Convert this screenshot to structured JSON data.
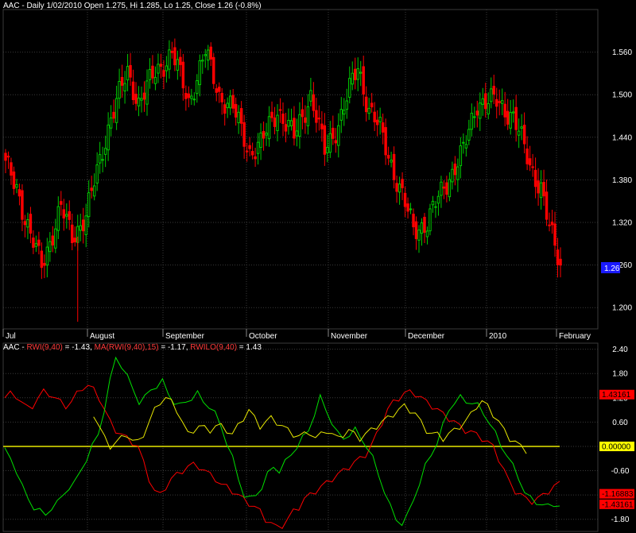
{
  "chart_data": [
    {
      "type": "candlestick",
      "title": "AAC - Daily 1/02/2010 Open 1.275, Hi 1.285, Lo 1.25, Close 1.26 (-0.8%)",
      "ylim": [
        1.17,
        1.62
      ],
      "yticks": [
        "1.560",
        "1.500",
        "1.440",
        "1.380",
        "1.320",
        "1.260",
        "1.200"
      ],
      "last_price_label": "1.26",
      "x_labels": [
        "Jul",
        "August",
        "September",
        "October",
        "November",
        "December",
        "2010",
        "February"
      ],
      "grid": true,
      "colors": {
        "up": "#00c800",
        "down": "#ff0000",
        "grid": "#3a3a3a"
      },
      "waypoints": [
        {
          "bar": 0,
          "close": 1.4
        },
        {
          "bar": 4,
          "close": 1.37
        },
        {
          "bar": 9,
          "close": 1.3
        },
        {
          "bar": 13,
          "close": 1.26
        },
        {
          "bar": 20,
          "close": 1.34
        },
        {
          "bar": 24,
          "close": 1.3
        },
        {
          "bar": 29,
          "close": 1.33
        },
        {
          "bar": 33,
          "close": 1.39
        },
        {
          "bar": 38,
          "close": 1.47
        },
        {
          "bar": 44,
          "close": 1.53
        },
        {
          "bar": 48,
          "close": 1.49
        },
        {
          "bar": 54,
          "close": 1.53
        },
        {
          "bar": 60,
          "close": 1.56
        },
        {
          "bar": 66,
          "close": 1.49
        },
        {
          "bar": 72,
          "close": 1.56
        },
        {
          "bar": 77,
          "close": 1.5
        },
        {
          "bar": 82,
          "close": 1.48
        },
        {
          "bar": 88,
          "close": 1.42
        },
        {
          "bar": 92,
          "close": 1.43
        },
        {
          "bar": 98,
          "close": 1.48
        },
        {
          "bar": 104,
          "close": 1.44
        },
        {
          "bar": 110,
          "close": 1.5
        },
        {
          "bar": 115,
          "close": 1.42
        },
        {
          "bar": 120,
          "close": 1.46
        },
        {
          "bar": 127,
          "close": 1.54
        },
        {
          "bar": 131,
          "close": 1.48
        },
        {
          "bar": 135,
          "close": 1.45
        },
        {
          "bar": 141,
          "close": 1.38
        },
        {
          "bar": 147,
          "close": 1.31
        },
        {
          "bar": 152,
          "close": 1.32
        },
        {
          "bar": 158,
          "close": 1.37
        },
        {
          "bar": 165,
          "close": 1.42
        },
        {
          "bar": 170,
          "close": 1.49
        },
        {
          "bar": 177,
          "close": 1.49
        },
        {
          "bar": 183,
          "close": 1.47
        },
        {
          "bar": 189,
          "close": 1.4
        },
        {
          "bar": 193,
          "close": 1.37
        },
        {
          "bar": 196,
          "close": 1.31
        },
        {
          "bar": 200,
          "close": 1.26
        }
      ],
      "bar_count": 201
    },
    {
      "type": "line",
      "title": "RWI indicator",
      "header": [
        {
          "text": "AAC - ",
          "color": "#ffffff"
        },
        {
          "text": "RWI(9,40)",
          "color": "#ff3b3b"
        },
        {
          "text": " = -1.43, ",
          "color": "#ffffff"
        },
        {
          "text": "MA(RWI(9,40),15)",
          "color": "#ff3b3b"
        },
        {
          "text": " = -1.17, ",
          "color": "#ffffff"
        },
        {
          "text": "RWILO(9,40)",
          "color": "#ff3b3b"
        },
        {
          "text": " = 1.43",
          "color": "#ffffff"
        }
      ],
      "ylim": [
        -2.1,
        2.55
      ],
      "yticks": [
        "2.40",
        "1.80",
        "1.20",
        "0.60",
        "0",
        "-0.60",
        "-1.20",
        "-1.80"
      ],
      "zero_line": 0,
      "value_labels": [
        {
          "text": "1.43161",
          "value": 1.28,
          "bg": "#ff0000",
          "fg": "#000000"
        },
        {
          "text": "0.00000",
          "value": 0,
          "bg": "#ffff00",
          "fg": "#000000"
        },
        {
          "text": "-1.16883",
          "value": -1.17,
          "bg": "#ff0000",
          "fg": "#000000"
        },
        {
          "text": "-1.43161",
          "value": -1.43,
          "bg": "#ff0000",
          "fg": "#000000"
        }
      ],
      "series": [
        {
          "color": "#ff0000",
          "values": [
            1.2,
            1.3,
            1.25,
            1.1,
            0.95,
            1.0,
            1.2,
            1.35,
            1.3,
            1.2,
            1.1,
            1.0,
            1.1,
            1.3,
            1.45,
            1.5,
            1.4,
            1.2,
            0.9,
            0.6,
            0.4,
            0.3,
            0.2,
            0.1,
            0.0,
            -0.4,
            -0.8,
            -1.1,
            -1.2,
            -1.0,
            -0.8,
            -0.7,
            -0.6,
            -0.5,
            -0.45,
            -0.5,
            -0.6,
            -0.7,
            -0.8,
            -0.95,
            -1.0,
            -1.1,
            -1.2,
            -1.3,
            -1.4,
            -1.5,
            -1.6,
            -1.8,
            -1.9,
            -2.0,
            -1.95,
            -1.8,
            -1.6,
            -1.5,
            -1.3,
            -1.2,
            -1.1,
            -1.0,
            -0.9,
            -0.8,
            -0.7,
            -0.6,
            -0.5,
            -0.4,
            -0.3,
            -0.2,
            0.0,
            0.3,
            0.6,
            0.9,
            1.1,
            1.2,
            1.3,
            1.35,
            1.3,
            1.2,
            1.1,
            1.0,
            0.9,
            0.8,
            0.7,
            0.6,
            0.5,
            0.4,
            0.35,
            0.3,
            0.2,
            0.1,
            0.0,
            -0.3,
            -0.6,
            -0.9,
            -1.1,
            -1.2,
            -1.3,
            -1.35,
            -1.3,
            -1.2,
            -1.1,
            -1.0,
            -0.9
          ]
        },
        {
          "color": "#00e000",
          "values": [
            -0.1,
            -0.3,
            -0.6,
            -1.0,
            -1.3,
            -1.5,
            -1.6,
            -1.7,
            -1.5,
            -1.4,
            -1.2,
            -1.0,
            -0.9,
            -0.6,
            -0.3,
            0.0,
            0.3,
            0.9,
            1.6,
            2.2,
            2.0,
            1.7,
            1.4,
            1.1,
            1.2,
            1.4,
            1.5,
            1.6,
            1.3,
            1.1,
            1.0,
            1.1,
            1.2,
            1.3,
            1.1,
            1.0,
            0.8,
            0.5,
            0.1,
            -0.3,
            -0.8,
            -1.2,
            -1.3,
            -1.2,
            -1.0,
            -0.7,
            -0.5,
            -0.6,
            -0.4,
            -0.2,
            0.0,
            0.2,
            0.4,
            0.8,
            1.2,
            0.9,
            0.6,
            0.3,
            0.2,
            0.3,
            0.4,
            0.2,
            0.0,
            -0.3,
            -0.7,
            -1.1,
            -1.5,
            -1.8,
            -1.9,
            -1.7,
            -1.3,
            -0.9,
            -0.5,
            -0.2,
            0.1,
            0.5,
            0.9,
            1.1,
            1.2,
            1.1,
            1.1,
            1.0,
            0.8,
            0.6,
            0.3,
            0.0,
            -0.2,
            -0.5,
            -0.8,
            -1.1,
            -1.3,
            -1.4,
            -1.4,
            -1.5,
            -1.45,
            -1.43
          ]
        },
        {
          "color": "#e8e800",
          "values": [
            null,
            null,
            null,
            null,
            null,
            null,
            null,
            null,
            null,
            null,
            null,
            null,
            null,
            null,
            null,
            null,
            0.8,
            0.5,
            0.2,
            0.0,
            0.1,
            0.2,
            0.3,
            0.15,
            0.1,
            0.3,
            0.6,
            0.9,
            1.1,
            1.2,
            1.1,
            0.9,
            0.6,
            0.3,
            0.4,
            0.5,
            0.45,
            0.4,
            0.5,
            0.5,
            0.4,
            0.3,
            0.5,
            0.7,
            0.9,
            0.7,
            0.5,
            0.6,
            0.7,
            0.6,
            0.5,
            0.4,
            0.3,
            0.25,
            0.3,
            0.35,
            0.2,
            0.3,
            0.4,
            0.3,
            0.2,
            0.3,
            0.4,
            0.3,
            0.2,
            0.3,
            0.4,
            0.5,
            0.6,
            0.7,
            0.8,
            0.9,
            1.0,
            0.9,
            0.8,
            0.6,
            0.4,
            0.3,
            0.3,
            0.2,
            0.3,
            0.4,
            0.5,
            0.6,
            0.8,
            1.0,
            1.1,
            1.0,
            0.8,
            0.6,
            0.4,
            0.2,
            0.1,
            0.0,
            -0.1,
            null,
            null,
            null,
            null,
            null,
            null
          ]
        }
      ]
    }
  ]
}
